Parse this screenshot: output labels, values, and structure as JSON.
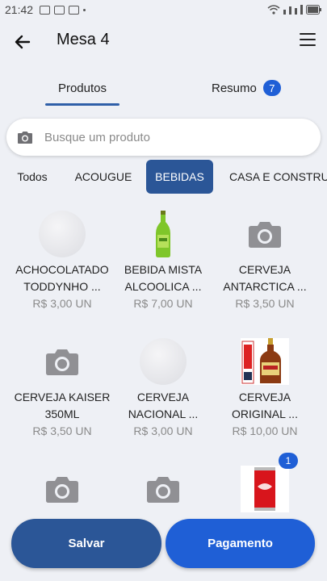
{
  "status": {
    "time": "21:42"
  },
  "header": {
    "title": "Mesa 4"
  },
  "tabs": [
    {
      "label": "Produtos",
      "active": true
    },
    {
      "label": "Resumo",
      "badge": "7"
    }
  ],
  "search": {
    "placeholder": "Busque um produto"
  },
  "categories": [
    {
      "label": "Todos"
    },
    {
      "label": "ACOUGUE"
    },
    {
      "label": "BEBIDAS",
      "active": true
    },
    {
      "label": "CASA E CONSTRUC"
    }
  ],
  "products": [
    {
      "name": "ACHOCOLATADO TODDYNHO ...",
      "line1": "ACHOCOLATADO",
      "line2": "TODDYNHO ...",
      "price": "R$ 3,00 UN",
      "image": "circle-placeholder"
    },
    {
      "name": "BEBIDA MISTA ALCOOLICA ...",
      "line1": "BEBIDA MISTA",
      "line2": "ALCOOLICA ...",
      "price": "R$ 7,00 UN",
      "image": "green-bottle"
    },
    {
      "name": "CERVEJA ANTARCTICA ...",
      "line1": "CERVEJA",
      "line2": "ANTARCTICA ...",
      "price": "R$ 3,50 UN",
      "image": "camera-icon"
    },
    {
      "name": "CERVEJA KAISER 350ML",
      "line1": "CERVEJA KAISER",
      "line2": "350ML",
      "price": "R$ 3,50 UN",
      "image": "camera-icon"
    },
    {
      "name": "CERVEJA NACIONAL ...",
      "line1": "CERVEJA",
      "line2": "NACIONAL ...",
      "price": "R$ 3,00 UN",
      "image": "circle-placeholder"
    },
    {
      "name": "CERVEJA ORIGINAL ...",
      "line1": "CERVEJA",
      "line2": "ORIGINAL ...",
      "price": "R$ 10,00 UN",
      "image": "original-beer"
    },
    {
      "image": "camera-icon"
    },
    {
      "image": "camera-icon"
    },
    {
      "image": "coca-cola-can",
      "quantity": "1"
    }
  ],
  "footer": {
    "save_label": "Salvar",
    "payment_label": "Pagamento"
  },
  "colors": {
    "primary": "#2b5697",
    "accent": "#1f5fd6",
    "background": "#eef0f5"
  }
}
